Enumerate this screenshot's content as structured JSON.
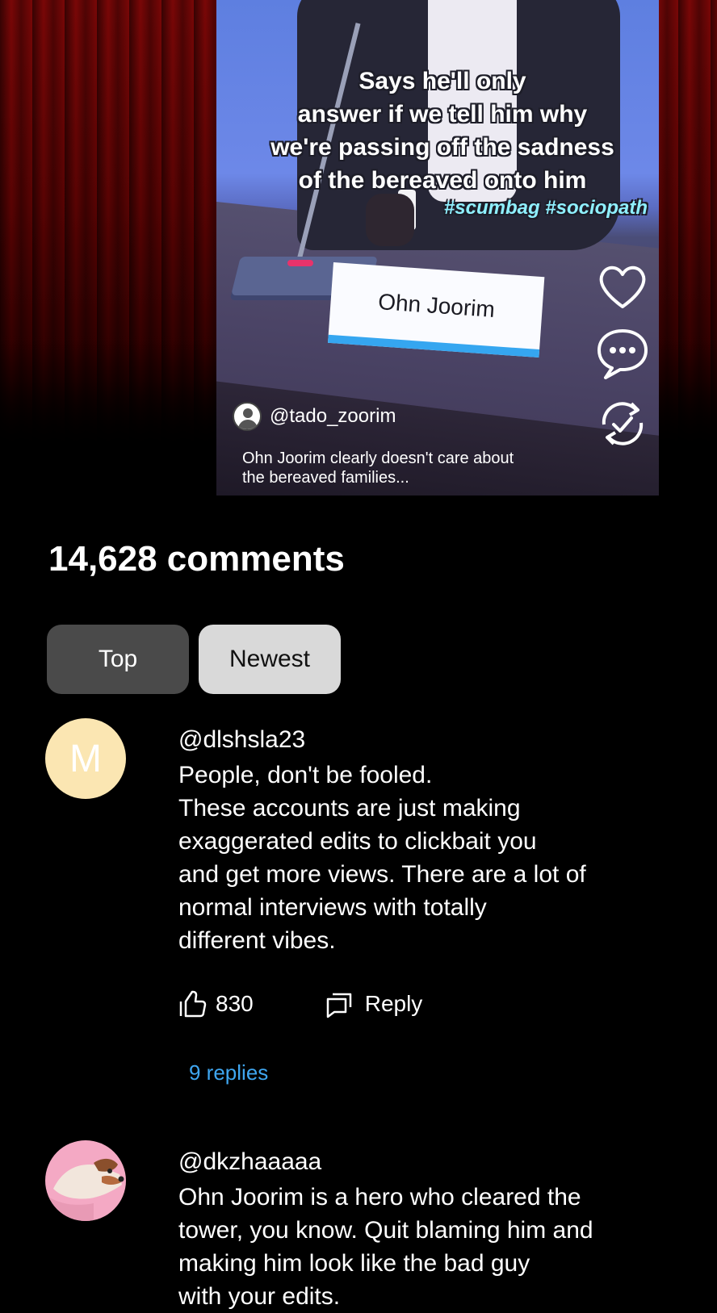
{
  "video": {
    "caption_lines": [
      "Says he'll only",
      "answer if we tell him why",
      "we're passing off the sadness",
      "of the bereaved onto him"
    ],
    "hashtags": "#scumbag #sociopath",
    "nameplate": "Ohn Joorim",
    "author_handle": "@tado_zoorim",
    "description_lines": [
      "Ohn Joorim clearly doesn't care about",
      "the bereaved families..."
    ],
    "side_icons": [
      "heart-icon",
      "comment-bubble-icon",
      "repost-icon"
    ]
  },
  "comments_header": {
    "count_label": "14,628 comments"
  },
  "sort_tabs": [
    {
      "label": "Top",
      "selected": true
    },
    {
      "label": "Newest",
      "selected": false
    }
  ],
  "comments": [
    {
      "avatar_letter": "M",
      "avatar_color": "#fbe6b2",
      "username": "@dlshsla23",
      "text_lines": [
        "People, don't be fooled.",
        "These accounts are just making",
        "exaggerated edits to clickbait you",
        "and get more views. There are a lot of",
        "normal interviews with totally",
        "different vibes."
      ],
      "likes": "830",
      "reply_label": "Reply",
      "replies_link": "9 replies"
    },
    {
      "avatar_color": "#f4a9c4",
      "username": "@dkzhaaaaa",
      "text_lines": [
        "Ohn Joorim is a hero who cleared the",
        "tower, you know. Quit blaming him and",
        "making him look like the bad guy",
        "with your edits."
      ]
    }
  ],
  "colors": {
    "background": "#000000",
    "accent_link": "#3fa6f0",
    "hashtag": "#8ff0ff",
    "selected_tab": "#4a4a4a",
    "unselected_tab": "#d9d9d9"
  }
}
